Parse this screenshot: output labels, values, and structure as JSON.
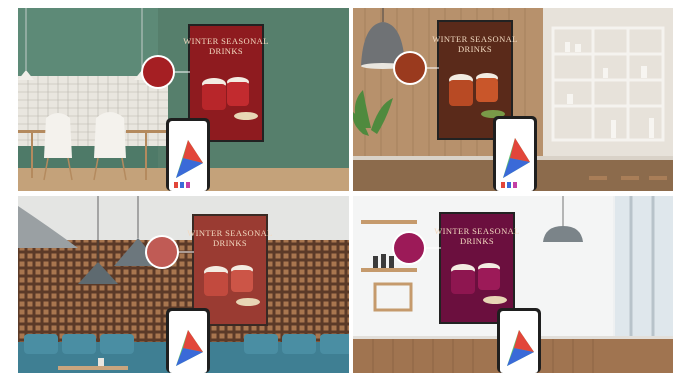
{
  "poster": {
    "title_line1": "WINTER SEASONAL",
    "title_line2": "DRINKS"
  },
  "panels": [
    {
      "scene": "green-cafe",
      "poster_color": "#8e1b1f",
      "swatch_color": "#a51f23"
    },
    {
      "scene": "wood-cafe",
      "poster_color": "#5a2a1a",
      "swatch_color": "#9a3a1e"
    },
    {
      "scene": "brick-cafe",
      "poster_color": "#9a3b32",
      "swatch_color": "#c05b55"
    },
    {
      "scene": "white-cafe",
      "poster_color": "#6b0f3e",
      "swatch_color": "#9c1a58"
    }
  ]
}
